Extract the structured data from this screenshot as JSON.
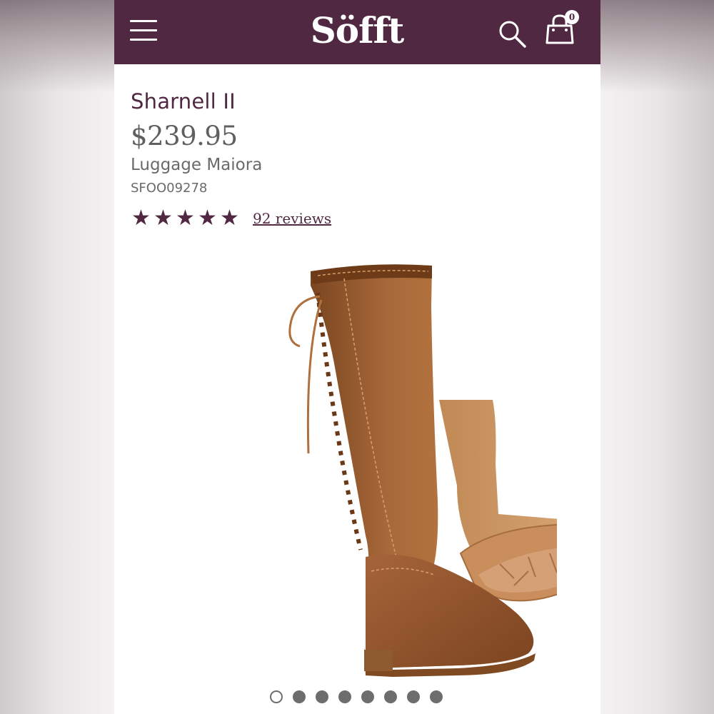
{
  "header": {
    "logo_text": "Söfft",
    "bag_count": "0",
    "background_color": "#512841"
  },
  "product": {
    "name": "Sharnell II",
    "price": "$239.95",
    "color": "Luggage Maiora",
    "sku": "SFOO09278",
    "rating": 5,
    "rating_max": 5,
    "reviews_label": "92 reviews"
  },
  "carousel": {
    "total_slides": 8,
    "active_slide": 1
  },
  "icons": [
    "menu-icon",
    "search-icon",
    "shopping-bag-icon",
    "star-icon"
  ]
}
